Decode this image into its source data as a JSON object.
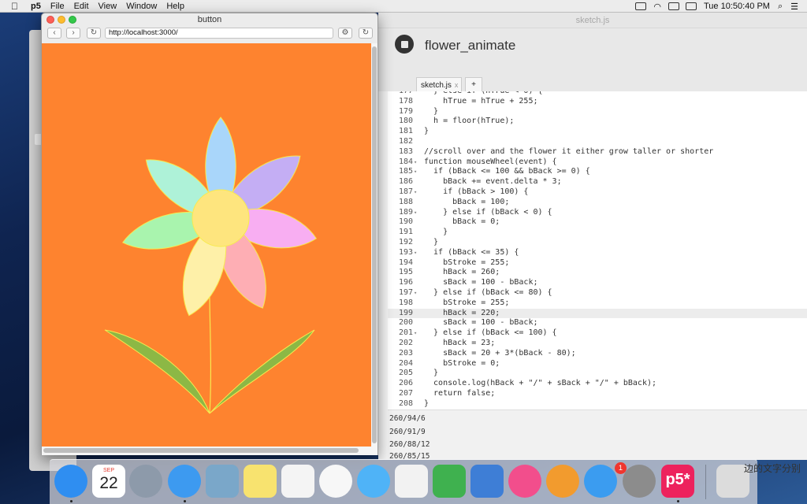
{
  "menubar": {
    "apple": "",
    "app_name": "p5",
    "items": [
      "File",
      "Edit",
      "View",
      "Window",
      "Help"
    ],
    "clock": "Tue 10:50:40 PM"
  },
  "browser": {
    "title": "button",
    "url": "http://localhost:3000/",
    "back_icon": "‹",
    "forward_icon": "›",
    "reload_icon": "↻",
    "gear_icon": "⚙",
    "canvas_background": "#fe832f"
  },
  "editor": {
    "window_title": "sketch.js",
    "sketch_name": "flower_animate",
    "tabs": [
      {
        "label": "sketch.js",
        "close": "x"
      },
      {
        "label": "+"
      }
    ],
    "code_lines": [
      {
        "n": "177",
        "fold": "",
        "text": "  } else if (hTrue < 0) {"
      },
      {
        "n": "178",
        "fold": "",
        "text": "    hTrue = hTrue + 255;"
      },
      {
        "n": "179",
        "fold": "",
        "text": "  }"
      },
      {
        "n": "180",
        "fold": "",
        "text": "  h = floor(hTrue);"
      },
      {
        "n": "181",
        "fold": "",
        "text": "}"
      },
      {
        "n": "182",
        "fold": "",
        "text": ""
      },
      {
        "n": "183",
        "fold": "",
        "text": "//scroll over and the flower it either grow taller or shorter"
      },
      {
        "n": "184",
        "fold": "▾",
        "text": "function mouseWheel(event) {"
      },
      {
        "n": "185",
        "fold": "▾",
        "text": "  if (bBack <= 100 && bBack >= 0) {"
      },
      {
        "n": "186",
        "fold": "",
        "text": "    bBack += event.delta * 3;"
      },
      {
        "n": "187",
        "fold": "▾",
        "text": "    if (bBack > 100) {"
      },
      {
        "n": "188",
        "fold": "",
        "text": "      bBack = 100;"
      },
      {
        "n": "189",
        "fold": "▾",
        "text": "    } else if (bBack < 0) {"
      },
      {
        "n": "190",
        "fold": "",
        "text": "      bBack = 0;"
      },
      {
        "n": "191",
        "fold": "",
        "text": "    }"
      },
      {
        "n": "192",
        "fold": "",
        "text": "  }"
      },
      {
        "n": "193",
        "fold": "▾",
        "text": "  if (bBack <= 35) {"
      },
      {
        "n": "194",
        "fold": "",
        "text": "    bStroke = 255;"
      },
      {
        "n": "195",
        "fold": "",
        "text": "    hBack = 260;"
      },
      {
        "n": "196",
        "fold": "",
        "text": "    sBack = 100 - bBack;"
      },
      {
        "n": "197",
        "fold": "▾",
        "text": "  } else if (bBack <= 80) {"
      },
      {
        "n": "198",
        "fold": "",
        "text": "    bStroke = 255;"
      },
      {
        "n": "199",
        "fold": "",
        "text": "    hBack = 220;"
      },
      {
        "n": "200",
        "fold": "",
        "text": "    sBack = 100 - bBack;"
      },
      {
        "n": "201",
        "fold": "▾",
        "text": "  } else if (bBack <= 100) {"
      },
      {
        "n": "202",
        "fold": "",
        "text": "    hBack = 23;"
      },
      {
        "n": "203",
        "fold": "",
        "text": "    sBack = 20 + 3*(bBack - 80);"
      },
      {
        "n": "204",
        "fold": "",
        "text": "    bStroke = 0;"
      },
      {
        "n": "205",
        "fold": "",
        "text": "  }"
      },
      {
        "n": "206",
        "fold": "",
        "text": "  console.log(hBack + \"/\" + sBack + \"/\" + bBack);"
      },
      {
        "n": "207",
        "fold": "",
        "text": "  return false;"
      },
      {
        "n": "208",
        "fold": "",
        "text": "}"
      }
    ],
    "highlighted_line": "199",
    "console_lines": [
      "260/94/6",
      "260/91/9",
      "260/88/12",
      "260/85/15"
    ],
    "overflow_text": "边的文字分别"
  },
  "dock": {
    "items": [
      {
        "name": "finder-icon",
        "color": "#2f8ef1",
        "running": true
      },
      {
        "name": "calendar-icon",
        "color": "#ffffff",
        "month": "SEP",
        "day": "22"
      },
      {
        "name": "launchpad-icon",
        "color": "#8d9aaa"
      },
      {
        "name": "safari-icon",
        "color": "#3d9af0",
        "running": true
      },
      {
        "name": "preview-icon",
        "color": "#7aa7c9"
      },
      {
        "name": "notes-icon",
        "color": "#f8e36f"
      },
      {
        "name": "reminders-icon",
        "color": "#f4f4f4"
      },
      {
        "name": "photos-icon",
        "color": "#f7f7f7"
      },
      {
        "name": "messages-icon",
        "color": "#4fb3f7"
      },
      {
        "name": "textedit-icon",
        "color": "#f2f2f2"
      },
      {
        "name": "numbers-icon",
        "color": "#3fb14f"
      },
      {
        "name": "keynote-icon",
        "color": "#3e7ed6"
      },
      {
        "name": "itunes-icon",
        "color": "#f24e8c"
      },
      {
        "name": "ibooks-icon",
        "color": "#f29b2e"
      },
      {
        "name": "appstore-icon",
        "color": "#3b9cf0",
        "badge": "1"
      },
      {
        "name": "system-preferences-icon",
        "color": "#8c8c8c"
      },
      {
        "name": "p5-icon",
        "color": "#ed225d",
        "label": "p5*",
        "running": true
      },
      {
        "name": "trash-icon",
        "color": "#dcdcdc"
      }
    ]
  },
  "flower": {
    "petal_colors": [
      "#a9d6fa",
      "#c4aef4",
      "#f8aef2",
      "#feaeb4",
      "#fef0a8",
      "#a9f4ae",
      "#aef2d8"
    ],
    "center_color": "#fee57e",
    "outline_color": "#f7ea50",
    "leaf_color": "#8cb845"
  }
}
